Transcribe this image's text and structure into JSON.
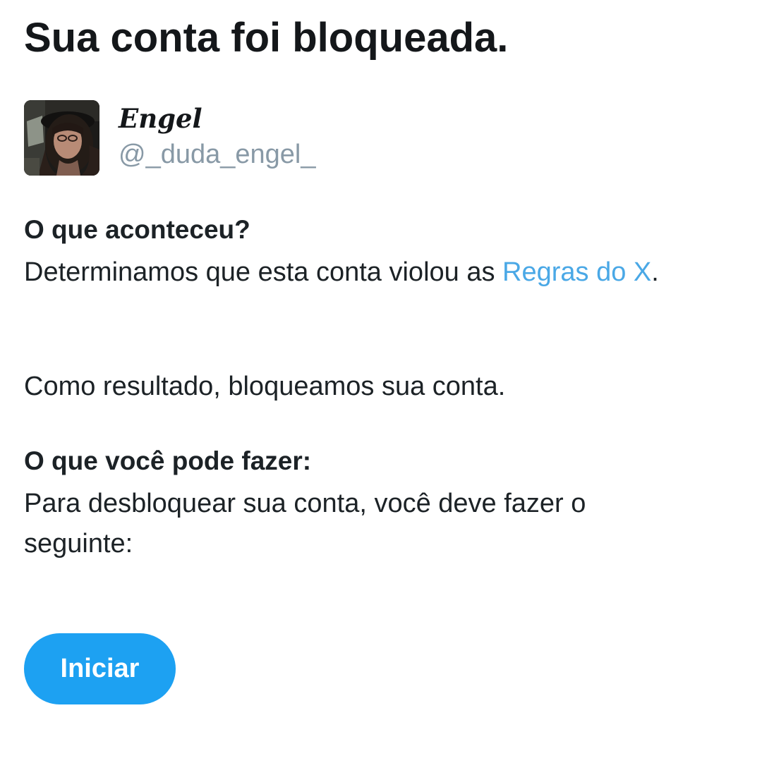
{
  "page": {
    "title": "Sua conta foi bloqueada."
  },
  "account": {
    "display_name": "Engel",
    "handle": "@_duda_engel_"
  },
  "what_happened": {
    "heading": "O que aconteceu?",
    "text_before_link": "Determinamos que esta conta violou as ",
    "link_label": "Regras do X",
    "text_after_link": "."
  },
  "result": {
    "text": "Como resultado, bloqueamos sua conta."
  },
  "what_you_can_do": {
    "heading": "O que você pode fazer:",
    "text": "Para desbloquear sua conta, você deve fazer o seguinte:"
  },
  "actions": {
    "start_label": "Iniciar"
  },
  "colors": {
    "link": "#4aa8e6",
    "button": "#1da1f2",
    "handle": "#8899a6",
    "text": "#14171a"
  }
}
